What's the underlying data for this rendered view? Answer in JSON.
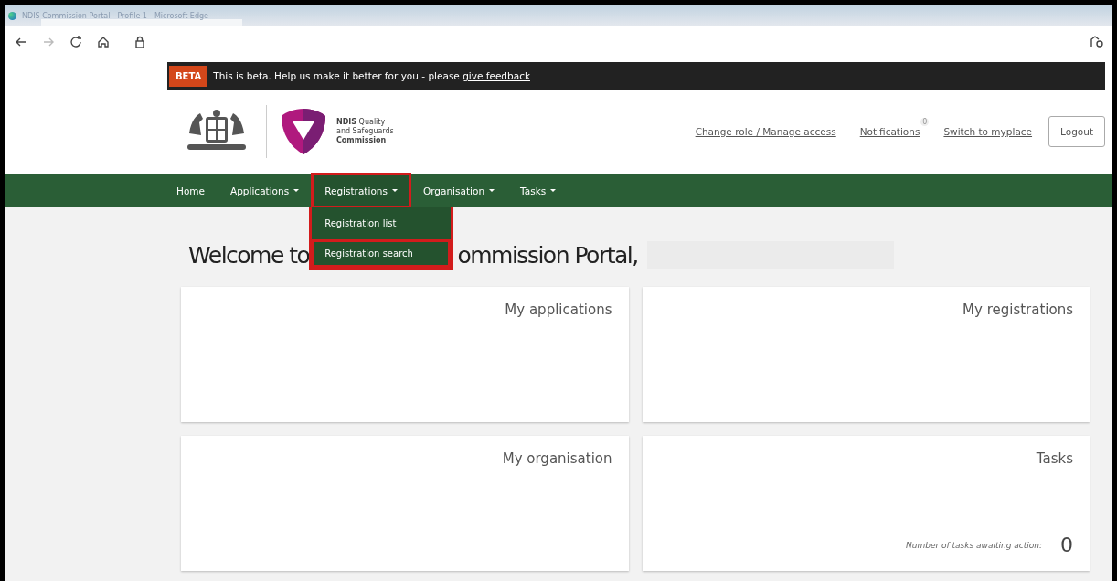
{
  "window": {
    "title": "NDIS Commission Portal - Profile 1 - Microsoft Edge"
  },
  "beta_bar": {
    "badge": "BETA",
    "message": "This is beta. Help us make it better for you - please ",
    "link": "give feedback"
  },
  "header": {
    "logo_text": [
      "**NDIS** Quality",
      "and Safeguards",
      "**Commission**"
    ],
    "links": [
      {
        "label": "Change role / Manage access",
        "kind": "link"
      },
      {
        "label": "Notifications",
        "kind": "notify",
        "count": "0"
      },
      {
        "label": "Switch to myplace",
        "kind": "link"
      }
    ],
    "logout": "Logout"
  },
  "nav": [
    {
      "label": "Home",
      "dropdown": false,
      "expanded": false
    },
    {
      "label": "Applications",
      "dropdown": true,
      "expanded": false
    },
    {
      "label": "Registrations",
      "dropdown": true,
      "expanded": true,
      "menu": [
        {
          "label": "Registration list",
          "selected": false
        },
        {
          "label": "Registration search",
          "selected": true
        }
      ]
    },
    {
      "label": "Organisation",
      "dropdown": true,
      "expanded": false
    },
    {
      "label": "Tasks",
      "dropdown": true,
      "expanded": false
    }
  ],
  "heading": {
    "before": "Welcome to",
    "after": "ommission Portal,"
  },
  "cards": [
    {
      "title": "My applications"
    },
    {
      "title": "My registrations"
    },
    {
      "title": "My organisation"
    },
    {
      "title": "Tasks",
      "note": "Number of tasks awaiting action:",
      "count": "0"
    }
  ]
}
